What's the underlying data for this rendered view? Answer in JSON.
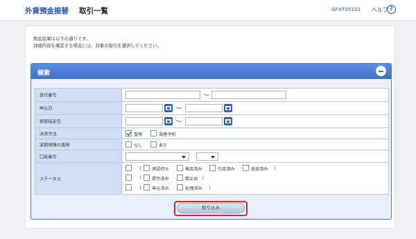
{
  "header": {
    "app_title": "外貨預金振替",
    "page_title": "取引一覧",
    "screen_id": "GFXT05101",
    "help_label": "ヘルプ",
    "help_icon_glyph": "?"
  },
  "messages": {
    "line1": "照会結果は以下の通りです。",
    "line2": "詳細内容を確認する場合には、対象の取引を選択してください。"
  },
  "search": {
    "title": "検索",
    "collapse_icon": "minus-circle-icon",
    "submit_label": "絞り込み",
    "highlight_color": "#e02424",
    "header_color": "#3f6fcc"
  },
  "form": {
    "receipt_number": {
      "label": "受付番号",
      "from": "",
      "to": "",
      "separator": "～"
    },
    "application_date": {
      "label": "申込日",
      "from": "",
      "to": "",
      "separator": "～"
    },
    "transfer_date": {
      "label": "振替指定日",
      "from": "",
      "to": "",
      "separator": "～"
    },
    "settlement_method": {
      "label": "決済方法",
      "options": [
        {
          "label": "直物",
          "checked": true
        },
        {
          "label": "為替予約",
          "checked": false
        }
      ]
    },
    "actual_rate": {
      "label": "実勢相場の適用",
      "options": [
        {
          "label": "なし",
          "checked": false
        },
        {
          "label": "あり",
          "checked": false
        }
      ]
    },
    "account_number": {
      "label": "口座番号",
      "branch": "",
      "type": ""
    },
    "status": {
      "label": "ステータス",
      "row1": [
        "承認待ち",
        "差戻済み",
        "引戻済み",
        "返却済み"
      ],
      "row2": [
        "提示済み",
        "取止め"
      ],
      "row3": [
        "申込済み",
        "処理済み"
      ],
      "open_paren": "（",
      "close_paren": "）"
    }
  }
}
